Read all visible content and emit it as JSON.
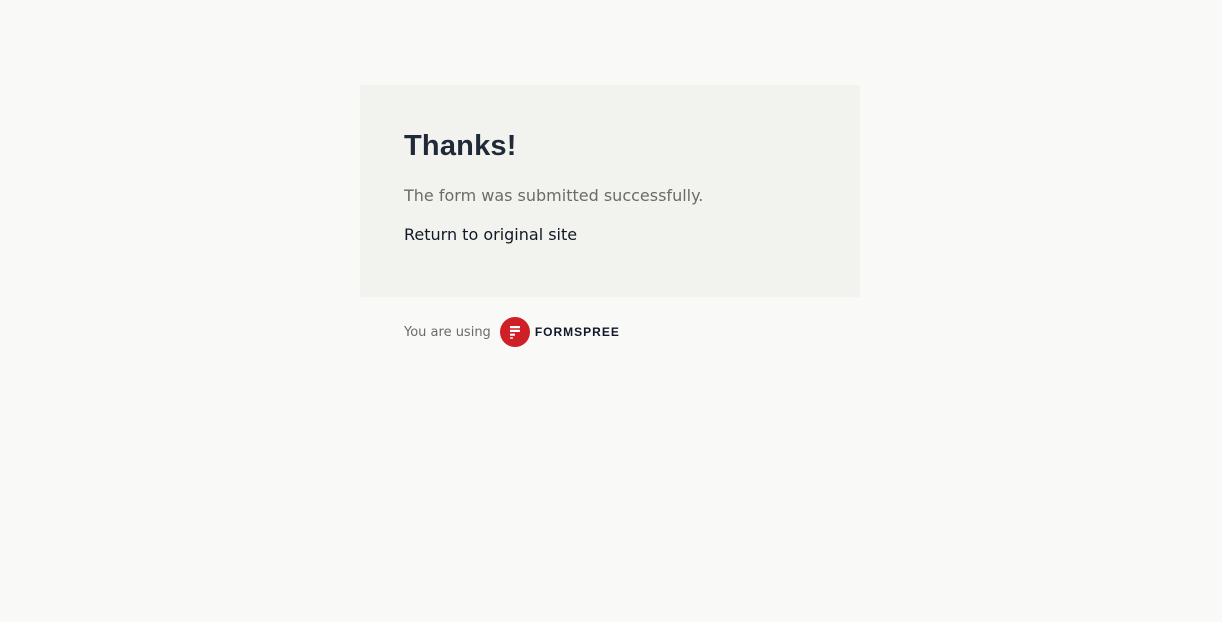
{
  "card": {
    "title": "Thanks!",
    "message": "The form was submitted successfully.",
    "return_link": "Return to original site"
  },
  "footer": {
    "label": "You are using",
    "brand": {
      "name": "FORMSPREE",
      "logo_icon": "formspree-logo-icon",
      "color": "#cf1f27"
    }
  },
  "colors": {
    "page_background": "#f9f9f8",
    "card_background": "#f2f2ef",
    "heading": "#1f2937",
    "muted_text": "#6b6b6b"
  }
}
